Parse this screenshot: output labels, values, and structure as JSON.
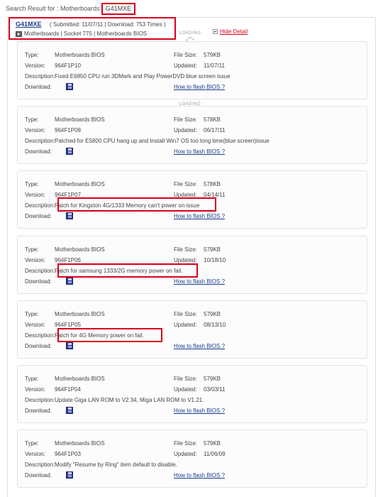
{
  "search": {
    "prefix": "Search Result for : Motherboards",
    "term": "G41MXE"
  },
  "product": {
    "name": "G41MXE",
    "meta": "( Submitted: 11/07/11  |  Download: 753 Times )",
    "crumbs": "Motherboards | Socket 775 | Motherboards BIOS"
  },
  "controls": {
    "hide_detail": "Hide Detail",
    "loading": "LOADING"
  },
  "labels": {
    "type": "Type:",
    "version": "Version:",
    "description": "Description:",
    "download": "Download:",
    "file_size": "File Size:",
    "updated": "Updated:",
    "how_to_flash": "How to flash BIOS ?"
  },
  "entries": [
    {
      "type": "Motherboards BIOS",
      "version": "964F1P10",
      "file_size": "579KB",
      "updated": "11/07/11",
      "description": "Fixed E6850 CPU run 3DMark and Play PowerDVD blue screen issue"
    },
    {
      "type": "Motherboards BIOS",
      "version": "964F1P08",
      "file_size": "578KB",
      "updated": "06/17/11",
      "description": "Patched for E5800 CPU hang up and Install Win7 OS too long time(blue screen)issue"
    },
    {
      "type": "Motherboards BIOS",
      "version": "964F1P07",
      "file_size": "578KB",
      "updated": "04/14/11",
      "description": "Patch for Kingston 4G/1333 Memory can't power on issue"
    },
    {
      "type": "Motherboards BIOS",
      "version": "964F1P06",
      "file_size": "579KB",
      "updated": "10/18/10",
      "description": "Patch for samsung 1333/2G memory power on fail."
    },
    {
      "type": "Motherboards BIOS",
      "version": "964F1P05",
      "file_size": "579KB",
      "updated": "08/13/10",
      "description": "Patch for 4G Memory power on fail."
    },
    {
      "type": "Motherboards BIOS",
      "version": "964F1P04",
      "file_size": "579KB",
      "updated": "03/03/11",
      "description": "Update Giga LAN ROM to V2.34, Miga LAN ROM to V1.21."
    },
    {
      "type": "Motherboards BIOS",
      "version": "964F1P03",
      "file_size": "579KB",
      "updated": "11/06/09",
      "description": "Modify \"Resume by Ring\" item default to disable."
    }
  ],
  "colors": {
    "highlight": "#d9001b",
    "link": "#1a3c8c"
  }
}
